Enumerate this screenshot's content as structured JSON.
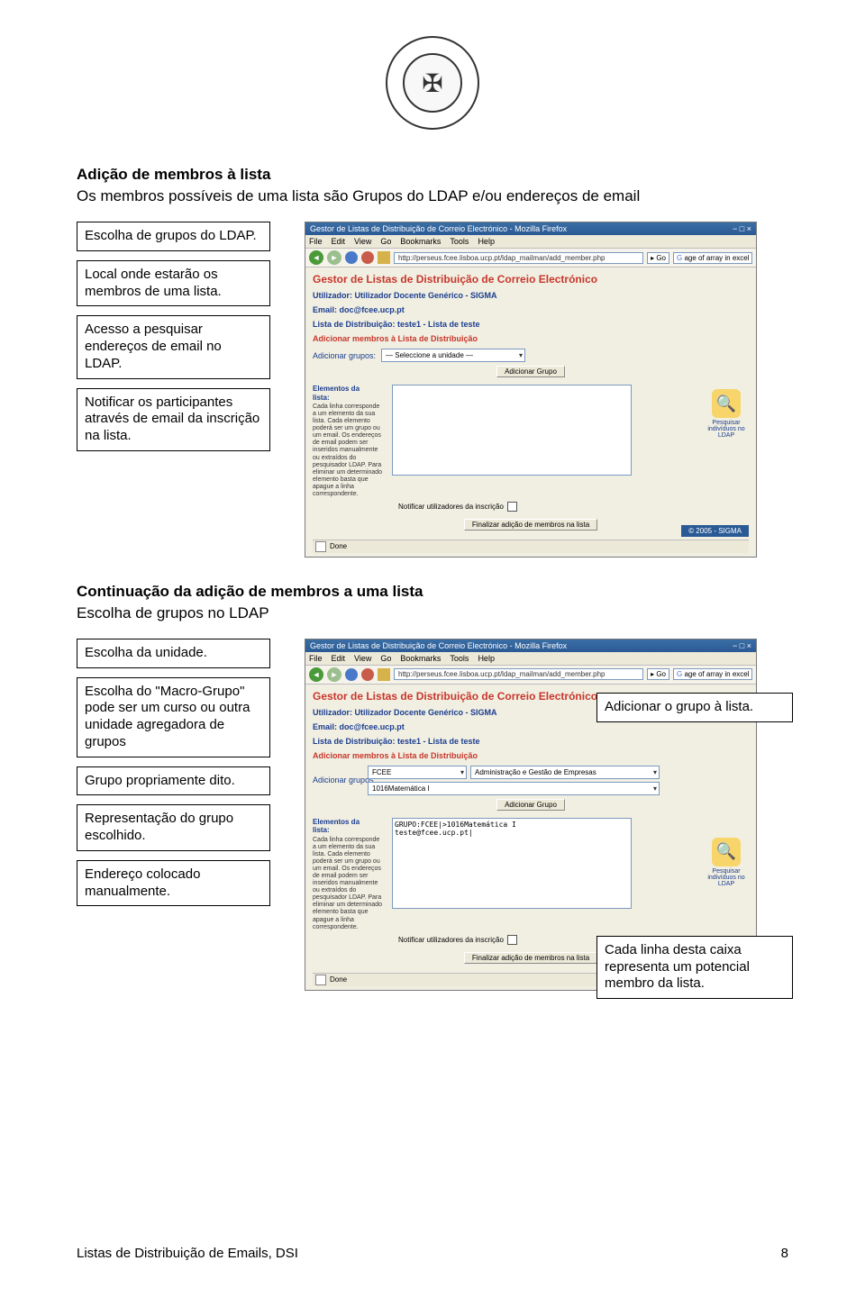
{
  "header": {
    "logo_alt": "Universitas Catholica Lusitana seal"
  },
  "section1": {
    "title": "Adição de membros à lista",
    "subtitle": "Os membros possíveis de uma lista são Grupos do LDAP e/ou endereços de email",
    "callout_choose": "Escolha de grupos do LDAP.",
    "callout_local": "Local onde estarão os membros de uma lista.",
    "callout_access": "Acesso a pesquisar endereços de email no LDAP.",
    "callout_notify": "Notificar os participantes através de email da inscrição na lista."
  },
  "section2": {
    "title": "Continuação da adição de membros a uma lista",
    "subtitle": "Escolha de grupos no LDAP",
    "callout_unit": "Escolha da unidade.",
    "callout_macro": "Escolha do \"Macro-Grupo\" pode ser um curso ou outra unidade agregadora de grupos",
    "callout_group": "Grupo propriamente dito.",
    "callout_repr": "Representação do grupo escolhido.",
    "callout_addr": "Endereço colocado manualmente.",
    "callout_add_right": "Adicionar o grupo à lista.",
    "callout_line_right": "Cada linha desta caixa representa um potencial membro da lista."
  },
  "browser": {
    "window_title": "Gestor de Listas de Distribuição de Correio Electrónico - Mozilla Firefox",
    "menu_file": "File",
    "menu_edit": "Edit",
    "menu_view": "View",
    "menu_go": "Go",
    "menu_bookmarks": "Bookmarks",
    "menu_tools": "Tools",
    "menu_help": "Help",
    "url": "http://perseus.fcee.lisboa.ucp.pt/ldap_mailman/add_member.php",
    "go_label": "Go",
    "search_placeholder": "age of array in excel",
    "content_title": "Gestor de Listas de Distribuição de Correio Electrónico",
    "user_line": "Utilizador: Utilizador Docente Genérico - SIGMA",
    "email_line": "Email: doc@fcee.ucp.pt",
    "list_line": "Lista de Distribuição: teste1 - Lista de teste",
    "add_members_title": "Adicionar membros à Lista de Distribuição",
    "add_groups_label": "Adicionar grupos:",
    "dropdown_unit_placeholder": "— Seleccione a unidade —",
    "dropdown_unit_value2": "FCEE",
    "dropdown_macro_value2": "Administração e Gestão de Empresas",
    "dropdown_group_value2": "1016Matemática I",
    "add_group_btn": "Adicionar Grupo",
    "elements_label": "Elementos da lista:",
    "elements_help": "Cada linha corresponde a um elemento da sua lista. Cada elemento poderá ser um grupo ou um email. Os endereços de email podem ser inseridos manualmente ou extraídos do pesquisador LDAP. Para eliminar um determinado elemento basta que apague a linha correspondente.",
    "textarea_line1": "GRUPO:FCEE|>1016Matemática I",
    "textarea_line2": "teste@fcee.ucp.pt|",
    "notify_checkbox_label": "Notificar utilizadores da inscrição",
    "search_ldap_label": "Pesquisar indivíduos no LDAP",
    "finalize_btn": "Finalizar adição de membros na lista",
    "copyright": "© 2005 - SIGMA",
    "status_done": "Done"
  },
  "footer": {
    "left": "Listas de Distribuição de Emails, DSI",
    "right": "8"
  }
}
